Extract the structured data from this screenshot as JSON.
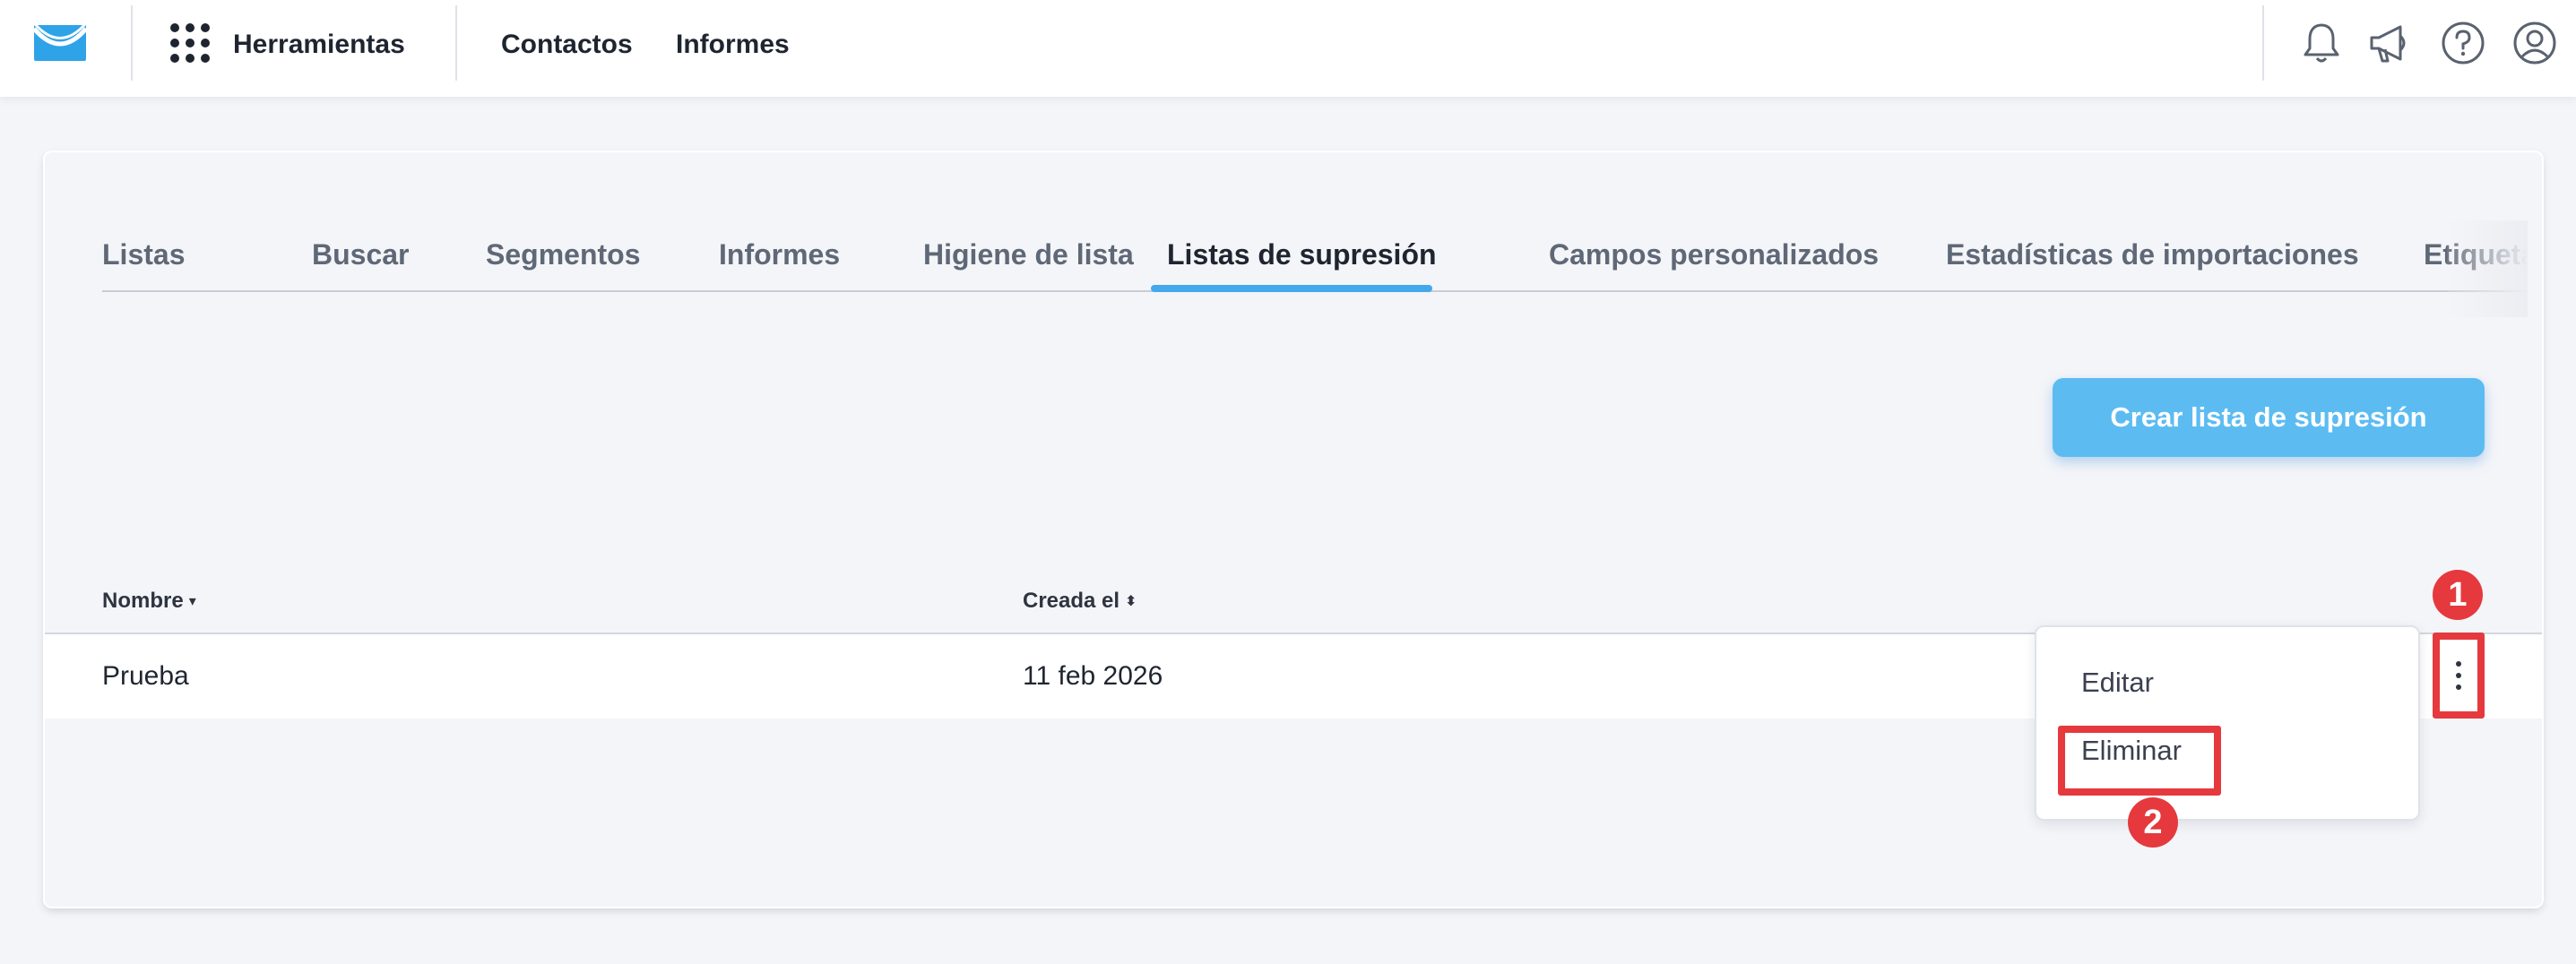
{
  "topbar": {
    "logo_icon": "envelope-logo-icon",
    "tools_label": "Herramientas",
    "nav": [
      "Contactos",
      "Informes"
    ],
    "icons": [
      "bell-icon",
      "megaphone-icon",
      "help-icon",
      "user-account-icon"
    ]
  },
  "tabs": [
    {
      "label": "Listas"
    },
    {
      "label": "Buscar"
    },
    {
      "label": "Segmentos"
    },
    {
      "label": "Informes"
    },
    {
      "label": "Higiene de lista"
    },
    {
      "label": "Listas de supresión",
      "active": true
    },
    {
      "label": "Campos personalizados"
    },
    {
      "label": "Estadísticas de importaciones"
    },
    {
      "label": "Etiquetas"
    }
  ],
  "actions": {
    "create_label": "Crear lista de supresión"
  },
  "table": {
    "columns": [
      "Nombre",
      "Creada el"
    ],
    "rows": [
      {
        "name": "Prueba",
        "created": "11 feb 2026"
      }
    ]
  },
  "menu": {
    "items": [
      "Editar",
      "Eliminar"
    ]
  },
  "annotations": {
    "step1": "1",
    "step2": "2"
  },
  "colors": {
    "accent": "#44a8ec",
    "button": "#5cbcf2",
    "highlight": "#e5393e"
  }
}
